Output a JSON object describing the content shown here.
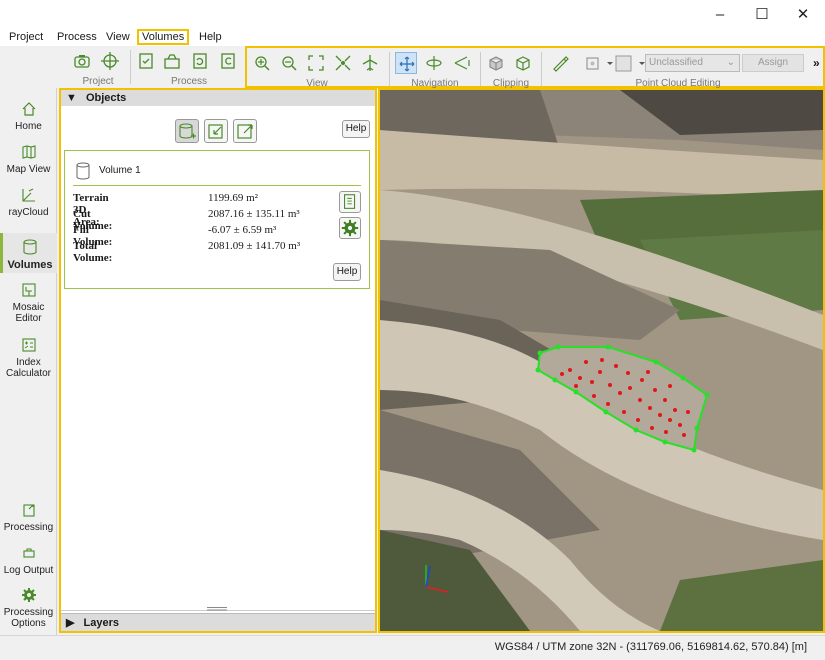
{
  "window": {
    "controls": {
      "minimize": "–",
      "maximize": "☐",
      "close": "✕"
    }
  },
  "menu": {
    "items": [
      "Project",
      "Process",
      "View",
      "Volumes",
      "Help"
    ],
    "active": "Volumes"
  },
  "toolbar": {
    "groups": {
      "project": "Project",
      "process": "Process",
      "view": "View",
      "navigation": "Navigation",
      "clipping": "Clipping",
      "point_cloud_editing": "Point Cloud Editing"
    },
    "class_combo": "Unclassified",
    "assign_label": "Assign",
    "overflow": "»",
    "highlight_color": "#f2c200"
  },
  "nav": {
    "items": {
      "home": "Home",
      "map_view": "Map View",
      "raycloud": "rayCloud",
      "volumes": "Volumes",
      "mosaic_editor": "Mosaic Editor",
      "index_calculator": "Index Calculator",
      "processing": "Processing",
      "log_output": "Log Output",
      "processing_options": "Processing Options"
    },
    "active": "Volumes",
    "active_color": "#8cb63c"
  },
  "objects": {
    "header": "Objects",
    "help": "Help",
    "volume": {
      "name": "Volume 1",
      "terrain_label": "Terrain 3D Area:",
      "terrain_value": "1199.69 m²",
      "cut_label": "Cut Volume:",
      "cut_value": "2087.16 ± 135.11 m³",
      "fill_label": "Fill Volume:",
      "fill_value": "-6.07 ± 6.59 m³",
      "total_label": "Total Volume:",
      "total_value": "2081.09 ± 141.70 m³",
      "help": "Help"
    }
  },
  "layers": {
    "header": "Layers"
  },
  "status": {
    "coordinates": "WGS84 / UTM zone 32N - (311769.06, 5169814.62, 570.84) [m]"
  }
}
